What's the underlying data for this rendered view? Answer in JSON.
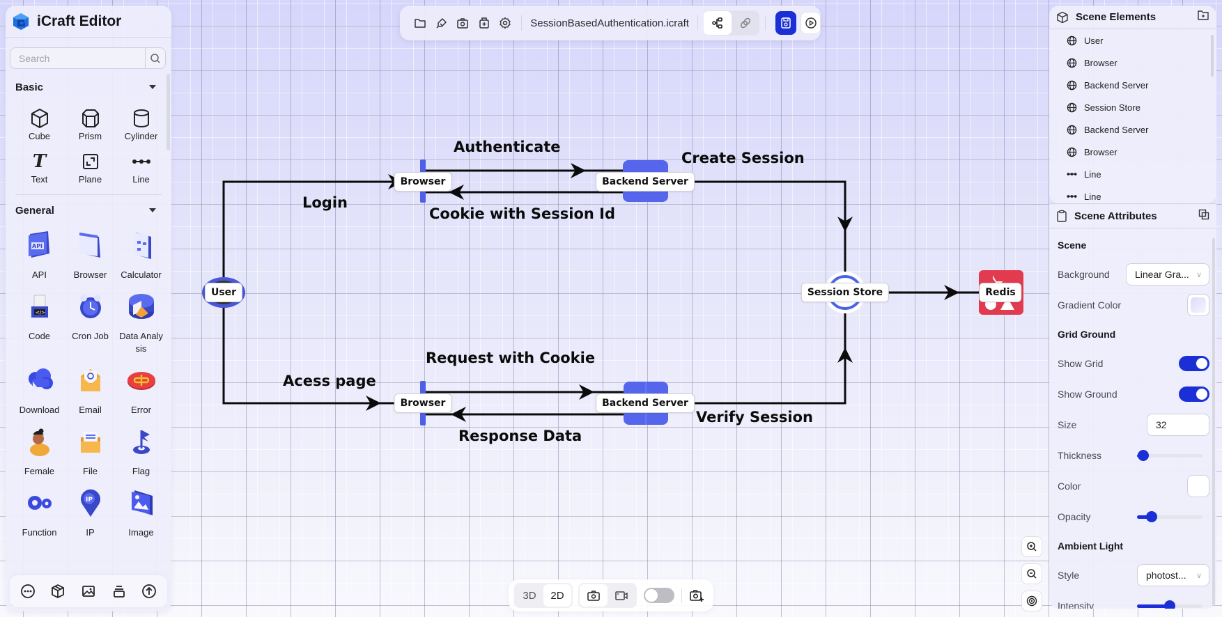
{
  "app": {
    "title": "iCraft Editor",
    "search_placeholder": "Search"
  },
  "library": {
    "sections": [
      {
        "title": "Basic",
        "items": [
          {
            "label": "Cube",
            "icon": "cube-icon"
          },
          {
            "label": "Prism",
            "icon": "prism-icon"
          },
          {
            "label": "Cylinder",
            "icon": "cylinder-icon"
          },
          {
            "label": "Text",
            "icon": "text-icon"
          },
          {
            "label": "Plane",
            "icon": "plane-icon"
          },
          {
            "label": "Line",
            "icon": "line-icon"
          }
        ]
      },
      {
        "title": "General",
        "items": [
          {
            "label": "API",
            "icon": "api-icon"
          },
          {
            "label": "Browser",
            "icon": "browser-icon"
          },
          {
            "label": "Calculator",
            "icon": "calculator-icon"
          },
          {
            "label": "Code",
            "icon": "code-icon"
          },
          {
            "label": "Cron Job",
            "icon": "cron-job-icon"
          },
          {
            "label": "Data Analysis",
            "icon": "data-analysis-icon"
          },
          {
            "label": "Download",
            "icon": "download-icon"
          },
          {
            "label": "Email",
            "icon": "email-icon"
          },
          {
            "label": "Error",
            "icon": "error-icon"
          },
          {
            "label": "Female",
            "icon": "female-icon"
          },
          {
            "label": "File",
            "icon": "file-icon"
          },
          {
            "label": "Flag",
            "icon": "flag-icon"
          },
          {
            "label": "Function",
            "icon": "function-icon"
          },
          {
            "label": "IP",
            "icon": "ip-icon"
          },
          {
            "label": "Image",
            "icon": "image-icon"
          }
        ]
      }
    ],
    "bottom_bar": [
      "more-icon",
      "model-icon",
      "image-icon",
      "layers-icon",
      "upload-icon"
    ]
  },
  "toolbar": {
    "icons": [
      "folder-icon",
      "brush-icon",
      "camera-icon",
      "export-icon",
      "settings-icon"
    ],
    "filename": "SessionBasedAuthentication.icraft",
    "mode_toggle": [
      "tree-icon",
      "link-icon"
    ],
    "save_icon": "save-icon",
    "play_icon": "play-icon"
  },
  "diagram": {
    "nodes": [
      {
        "id": "user",
        "label": "User"
      },
      {
        "id": "browser_top",
        "label": "Browser"
      },
      {
        "id": "backend_top",
        "label": "Backend Server"
      },
      {
        "id": "session_store",
        "label": "Session Store"
      },
      {
        "id": "redis",
        "label": "Redis"
      },
      {
        "id": "browser_bottom",
        "label": "Browser"
      },
      {
        "id": "backend_bottom",
        "label": "Backend Server"
      }
    ],
    "edges": [
      {
        "label": "Login"
      },
      {
        "label": "Authenticate"
      },
      {
        "label": "Cookie with Session Id"
      },
      {
        "label": "Create Session"
      },
      {
        "label": "Acess page"
      },
      {
        "label": "Request with Cookie"
      },
      {
        "label": "Response Data"
      },
      {
        "label": "Verify Session"
      }
    ],
    "colors": {
      "accent": "#4f5fe6",
      "redis": "#e23a4e",
      "line": "#0b0b0b"
    }
  },
  "scene_elements": {
    "title": "Scene Elements",
    "items": [
      {
        "label": "User",
        "icon": "globe-icon"
      },
      {
        "label": "Browser",
        "icon": "globe-icon"
      },
      {
        "label": "Backend Server",
        "icon": "globe-icon"
      },
      {
        "label": "Session Store",
        "icon": "globe-icon"
      },
      {
        "label": "Backend Server",
        "icon": "globe-icon"
      },
      {
        "label": "Browser",
        "icon": "globe-icon"
      },
      {
        "label": "Line",
        "icon": "line-icon"
      },
      {
        "label": "Line",
        "icon": "line-icon"
      }
    ]
  },
  "scene_attributes": {
    "title": "Scene Attributes",
    "scene_heading": "Scene",
    "background_label": "Background",
    "background_value": "Linear Gra...",
    "gradient_color_label": "Gradient Color",
    "gradient_color": "#dcdcfa",
    "grid_heading": "Grid Ground",
    "show_grid_label": "Show Grid",
    "show_grid": true,
    "show_ground_label": "Show Ground",
    "show_ground": true,
    "size_label": "Size",
    "size_value": "32",
    "thickness_label": "Thickness",
    "thickness_fraction": 0.1,
    "color_label": "Color",
    "color_value": "#ffffff",
    "opacity_label": "Opacity",
    "opacity_fraction": 0.22,
    "ambient_heading": "Ambient Light",
    "style_label": "Style",
    "style_value": "photost...",
    "intensity_label": "Intensity",
    "intensity_fraction": 0.5
  },
  "bottom_toolbar": {
    "view_3d": "3D",
    "view_2d": "2D",
    "active_view": "2D",
    "toggle_on": false
  },
  "accent_color": "#1b2fd6"
}
